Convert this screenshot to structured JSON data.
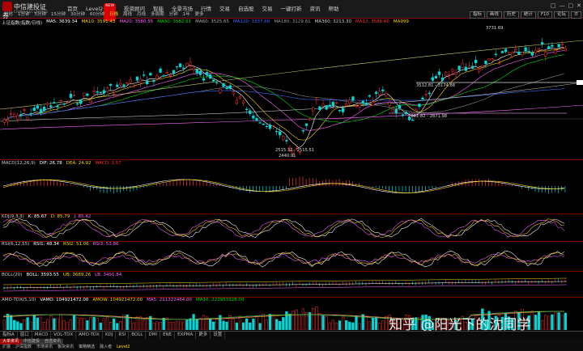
{
  "brand": {
    "name": "中信建投证券",
    "sub": "CHINA SECURITIES"
  },
  "menu": {
    "items": [
      "市场",
      "行情",
      "综合",
      "报价",
      "分析",
      "Level2",
      "投资顾问",
      "智能",
      "交易",
      "自选股",
      "自选股",
      "资讯",
      "帮助"
    ],
    "level2_badge": "NEW"
  },
  "menu_display": [
    {
      "label": "首页"
    },
    {
      "label": "Level2"
    },
    {
      "label": "投资顾问"
    },
    {
      "label": "智能"
    },
    {
      "label": "全景市场"
    },
    {
      "label": "行情"
    },
    {
      "label": "交易"
    },
    {
      "label": "自选股"
    },
    {
      "label": "交易"
    },
    {
      "label": "一键打新"
    },
    {
      "label": "资讯"
    },
    {
      "label": "帮助"
    }
  ],
  "window_controls": [
    "□",
    "—",
    "▢",
    "✕"
  ],
  "periods": [
    "分时",
    "1分钟",
    "5分钟",
    "15分钟",
    "30分钟",
    "60分钟",
    "日线",
    "周线",
    "月线",
    "多周期",
    "分钟",
    "1年",
    "更多"
  ],
  "active_period": "日线",
  "right_tools": [
    "指标",
    "画线",
    "历史",
    "统计",
    "F10",
    "论坛",
    "☰"
  ],
  "ma_legend": [
    {
      "text": "上证指数(指数/日线)",
      "color": "#e0e0e0"
    },
    {
      "text": "MA5: 3639.34",
      "color": "#ffffff"
    },
    {
      "text": "MA10: 3591.43",
      "color": "#ffd400"
    },
    {
      "text": "MA20: 3580.55",
      "color": "#ff66ff"
    },
    {
      "text": "MA30: 3582.61",
      "color": "#00e000"
    },
    {
      "text": "MA60: 3525.65",
      "color": "#aaaaaa"
    },
    {
      "text": "MA120: 3337.66",
      "color": "#3a6bff"
    },
    {
      "text": "MA180: 3129.61",
      "color": "#999999"
    },
    {
      "text": "MA360: 3213.30",
      "color": "#cccccc"
    },
    {
      "text": "MA12: 3588.60",
      "color": "#ff3030"
    },
    {
      "text": "MA999",
      "color": "#ffd400"
    }
  ],
  "annotations": {
    "high": "3731.69",
    "range_top": "3512.81 - 3174.88",
    "range_mid": "2861.82 - 2871.98",
    "range_low": "2515.32 - 2515.51",
    "low": "2440.91"
  },
  "indicators": {
    "macd": [
      {
        "text": "MACD(12,26,9)",
        "color": "#cccccc"
      },
      {
        "text": "DIF: 26.78",
        "color": "#ffffff"
      },
      {
        "text": "DEA: 24.92",
        "color": "#ffd400"
      },
      {
        "text": "MACD: 3.57",
        "color": "#ff3030"
      }
    ],
    "kdj": [
      {
        "text": "KDJ(9,3,3)",
        "color": "#cccccc"
      },
      {
        "text": "K: 85.67",
        "color": "#ffffff"
      },
      {
        "text": "D: 85.79",
        "color": "#ffd400"
      },
      {
        "text": "J: 85.42",
        "color": "#ff66ff"
      }
    ],
    "rsi": [
      {
        "text": "RSI(6,12,55)",
        "color": "#cccccc"
      },
      {
        "text": "RSI1: 48.34",
        "color": "#ffffff"
      },
      {
        "text": "RSI2: 51.06",
        "color": "#ffd400"
      },
      {
        "text": "RSI3: 53.86",
        "color": "#ff66ff"
      }
    ],
    "boll": [
      {
        "text": "BOLL(20)",
        "color": "#cccccc"
      },
      {
        "text": "BOLL: 3593.55",
        "color": "#ffffff"
      },
      {
        "text": "UB: 3689.26",
        "color": "#ffd400"
      },
      {
        "text": "LB: 3491.84",
        "color": "#ff66ff"
      }
    ],
    "amo": [
      {
        "text": "AMO-TDX(5,10)",
        "color": "#cccccc"
      },
      {
        "text": "VAMO: 104921472.00",
        "color": "#ffffff"
      },
      {
        "text": "AMOW: 104921472.00",
        "color": "#ffd400"
      },
      {
        "text": "MA5: 211322464.00",
        "color": "#ff66ff"
      },
      {
        "text": "MA10: 222953328.00",
        "color": "#00e000"
      }
    ]
  },
  "bottom_tabs": [
    "指标A",
    "窗口",
    "MACD",
    "VOL-TDX",
    "AMO-TDX",
    "KDJ",
    "RSI",
    "BOLL",
    "DMI",
    "ENE",
    "EXPMA",
    "更多",
    "设置"
  ],
  "status_rows": {
    "row1": [
      {
        "text": "大单资讯",
        "style": "red"
      },
      {
        "text": "中信建投",
        "style": "dark"
      },
      {
        "text": "自选资讯",
        "style": "dark"
      }
    ],
    "row2": [
      {
        "text": "扩展",
        "style": ""
      },
      {
        "text": "沪深指数",
        "style": ""
      },
      {
        "text": "市场资讯",
        "style": ""
      },
      {
        "text": "板块资讯",
        "style": ""
      },
      {
        "text": "策略精选",
        "style": ""
      },
      {
        "text": "融入者",
        "style": ""
      },
      {
        "text": "Level2",
        "style": "yl"
      }
    ]
  },
  "watermark": "知乎 @阳光下的沈同学",
  "colors": {
    "up": "#ff3030",
    "down": "#00d8d8",
    "panel_border": "#7a0000",
    "background": "#000000"
  }
}
